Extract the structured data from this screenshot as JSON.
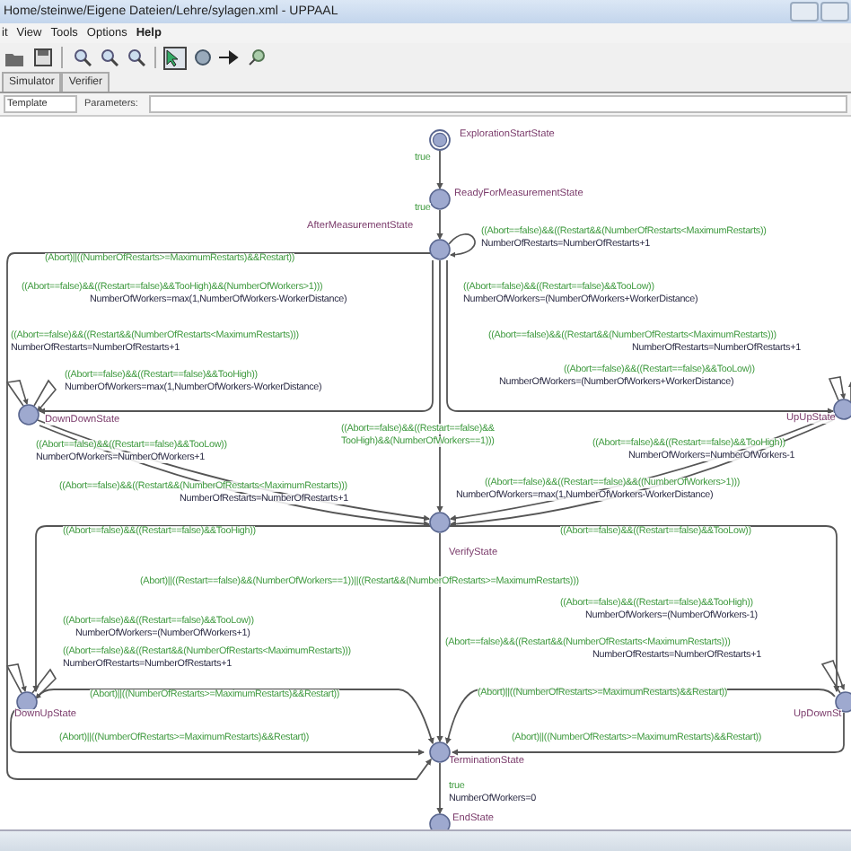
{
  "window": {
    "title": "Home/steinwe/Eigene Dateien/Lehre/sylagen.xml - UPPAAL"
  },
  "menu": [
    "it",
    "View",
    "Tools",
    "Options",
    "Help"
  ],
  "toolbar": [
    {
      "kind": "open",
      "selected": false
    },
    {
      "kind": "save",
      "selected": false
    },
    {
      "kind": "zoom-in",
      "selected": false
    },
    {
      "kind": "zoom-out",
      "selected": false
    },
    {
      "kind": "zoom-fit",
      "selected": false
    },
    {
      "kind": "select",
      "selected": true
    },
    {
      "kind": "location",
      "selected": false
    },
    {
      "kind": "edge",
      "selected": false
    },
    {
      "kind": "nail",
      "selected": false
    }
  ],
  "tabs": [
    {
      "label": "Simulator",
      "selected": false
    },
    {
      "label": "Verifier",
      "selected": false
    }
  ],
  "template": {
    "name": "Template",
    "parameters_label": "Parameters:"
  },
  "locations": [
    {
      "name": "ExplorationStartState",
      "initial": true
    },
    {
      "name": "ReadyForMeasurementState",
      "initial": false
    },
    {
      "name": "AfterMeasurementState",
      "initial": false
    },
    {
      "name": "DownDownState",
      "initial": false
    },
    {
      "name": "UpUpState",
      "initial": false
    },
    {
      "name": "VerifyState",
      "initial": false
    },
    {
      "name": "DownUpState",
      "initial": false
    },
    {
      "name": "UpDownSt",
      "initial": false
    },
    {
      "name": "TerminationState",
      "initial": false
    },
    {
      "name": "EndState",
      "initial": false
    }
  ],
  "labels": [
    {
      "kind": "guard",
      "text": "true"
    },
    {
      "kind": "guard",
      "text": "true"
    },
    {
      "kind": "guard",
      "text": "((Abort==false)&&((Restart&&(NumberOfRestarts<MaximumRestarts))"
    },
    {
      "kind": "update",
      "text": "NumberOfRestarts=NumberOfRestarts+1"
    },
    {
      "kind": "guard",
      "text": "(Abort)||((NumberOfRestarts>=MaximumRestarts)&&Restart))"
    },
    {
      "kind": "guard",
      "text": "((Abort==false)&&((Restart==false)&&TooHigh)&&(NumberOfWorkers>1)))"
    },
    {
      "kind": "update",
      "text": "NumberOfWorkers=max(1,NumberOfWorkers-WorkerDistance)"
    },
    {
      "kind": "guard",
      "text": "((Abort==false)&&((Restart==false)&&TooLow))"
    },
    {
      "kind": "update",
      "text": "NumberOfWorkers=(NumberOfWorkers+WorkerDistance)"
    },
    {
      "kind": "guard",
      "text": "((Abort==false)&&((Restart&&(NumberOfRestarts<MaximumRestarts)))"
    },
    {
      "kind": "update",
      "text": "NumberOfRestarts=NumberOfRestarts+1"
    },
    {
      "kind": "guard",
      "text": "((Abort==false)&&((Restart==false)&&TooHigh))"
    },
    {
      "kind": "update",
      "text": "NumberOfWorkers=max(1,NumberOfWorkers-WorkerDistance)"
    },
    {
      "kind": "guard",
      "text": "((Abort==false)&&((Restart==false)&&TooLow))"
    },
    {
      "kind": "update",
      "text": "NumberOfWorkers=NumberOfWorkers+1"
    },
    {
      "kind": "guard",
      "text": "((Abort==false)&&((Restart==false)&&"
    },
    {
      "kind": "guard",
      "text": "TooHigh)&&(NumberOfWorkers==1)))"
    },
    {
      "kind": "guard",
      "text": "((Abort==false)&&((Restart&&(NumberOfRestarts<MaximumRestarts)))"
    },
    {
      "kind": "update",
      "text": "NumberOfRestarts=NumberOfRestarts+1"
    },
    {
      "kind": "guard",
      "text": "((Abort==false)&&((Restart&&(NumberOfRestarts<MaximumRestarts)))"
    },
    {
      "kind": "update",
      "text": "NumberOfRestarts=NumberOfRestarts+1"
    },
    {
      "kind": "guard",
      "text": "((Abort==false)&&((Restart==false)&&TooLow))"
    },
    {
      "kind": "update",
      "text": "NumberOfWorkers=(NumberOfWorkers+WorkerDistance)"
    },
    {
      "kind": "guard",
      "text": "((Abort==false)&&((Restart==false)&&TooHigh))"
    },
    {
      "kind": "update",
      "text": "NumberOfWorkers=NumberOfWorkers-1"
    },
    {
      "kind": "guard",
      "text": "((Abort==false)&&((Restart==false)&&((NumberOfWorkers>1)))"
    },
    {
      "kind": "update",
      "text": "NumberOfWorkers=max(1,NumberOfWorkers-WorkerDistance)"
    },
    {
      "kind": "guard",
      "text": "((Abort==false)&&((Restart==false)&&TooHigh))"
    },
    {
      "kind": "guard",
      "text": "((Abort==false)&&((Restart==false)&&TooLow))"
    },
    {
      "kind": "guard",
      "text": "(Abort)||((Restart==false)&&(NumberOfWorkers==1))||((Restart&&(NumberOfRestarts>=MaximumRestarts)))"
    },
    {
      "kind": "guard",
      "text": "((Abort==false)&&((Restart==false)&&TooLow))"
    },
    {
      "kind": "update",
      "text": "NumberOfWorkers=(NumberOfWorkers+1)"
    },
    {
      "kind": "guard",
      "text": "((Abort==false)&&((Restart&&(NumberOfRestarts<MaximumRestarts)))"
    },
    {
      "kind": "update",
      "text": "NumberOfRestarts=NumberOfRestarts+1"
    },
    {
      "kind": "guard",
      "text": "((Abort==false)&&((Restart==false)&&TooHigh))"
    },
    {
      "kind": "update",
      "text": "NumberOfWorkers=(NumberOfWorkers-1)"
    },
    {
      "kind": "guard",
      "text": "(Abort==false)&&((Restart&&(NumberOfRestarts<MaximumRestarts)))"
    },
    {
      "kind": "update",
      "text": "NumberOfRestarts=NumberOfRestarts+1"
    },
    {
      "kind": "guard",
      "text": "(Abort)||((NumberOfRestarts>=MaximumRestarts)&&Restart))"
    },
    {
      "kind": "guard",
      "text": "(Abort)||((NumberOfRestarts>=MaximumRestarts)&&Restart))"
    },
    {
      "kind": "guard",
      "text": "(Abort)||((NumberOfRestarts>=MaximumRestarts)&&Restart))"
    },
    {
      "kind": "guard",
      "text": "(Abort)||((NumberOfRestarts>=MaximumRestarts)&&Restart))"
    },
    {
      "kind": "guard",
      "text": "true"
    },
    {
      "kind": "update",
      "text": "NumberOfWorkers=0"
    }
  ]
}
